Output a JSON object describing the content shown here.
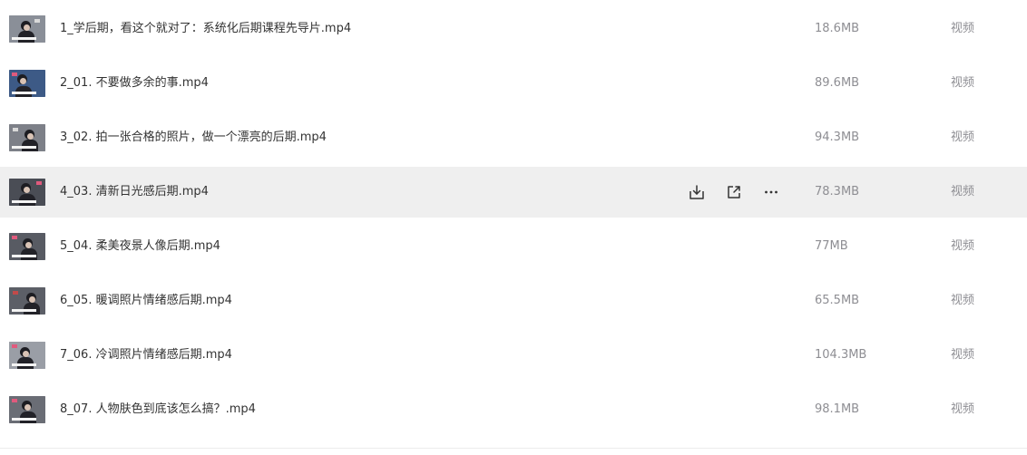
{
  "files": [
    {
      "name": "1_学后期，看这个就对了：系统化后期课程先导片.mp4",
      "size": "18.6MB",
      "type": "视频",
      "thumb_bg": "#8a8f98",
      "accent": "#d9d9d9"
    },
    {
      "name": "2_01. 不要做多余的事.mp4",
      "size": "89.6MB",
      "type": "视频",
      "thumb_bg": "#3d5a86",
      "accent": "#e05a7d"
    },
    {
      "name": "3_02. 拍一张合格的照片，做一个漂亮的后期.mp4",
      "size": "94.3MB",
      "type": "视频",
      "thumb_bg": "#7d8088",
      "accent": "#d9d9d9"
    },
    {
      "name": "4_03. 清新日光感后期.mp4",
      "size": "78.3MB",
      "type": "视频",
      "thumb_bg": "#4a4d55",
      "accent": "#e05a7d"
    },
    {
      "name": "5_04. 柔美夜景人像后期.mp4",
      "size": "77MB",
      "type": "视频",
      "thumb_bg": "#585b63",
      "accent": "#e05a7d"
    },
    {
      "name": "6_05. 暖调照片情绪感后期.mp4",
      "size": "65.5MB",
      "type": "视频",
      "thumb_bg": "#5c5f67",
      "accent": "#c24a4a"
    },
    {
      "name": "7_06. 冷调照片情绪感后期.mp4",
      "size": "104.3MB",
      "type": "视频",
      "thumb_bg": "#9a9ea6",
      "accent": "#e05a7d"
    },
    {
      "name": "8_07. 人物肤色到底该怎么搞？.mp4",
      "size": "98.1MB",
      "type": "视频",
      "thumb_bg": "#6a6d75",
      "accent": "#e05a7d"
    }
  ],
  "hovered_row": 3,
  "row_actions": [
    {
      "icon": "download-icon"
    },
    {
      "icon": "share-icon"
    },
    {
      "icon": "more-icon"
    }
  ]
}
